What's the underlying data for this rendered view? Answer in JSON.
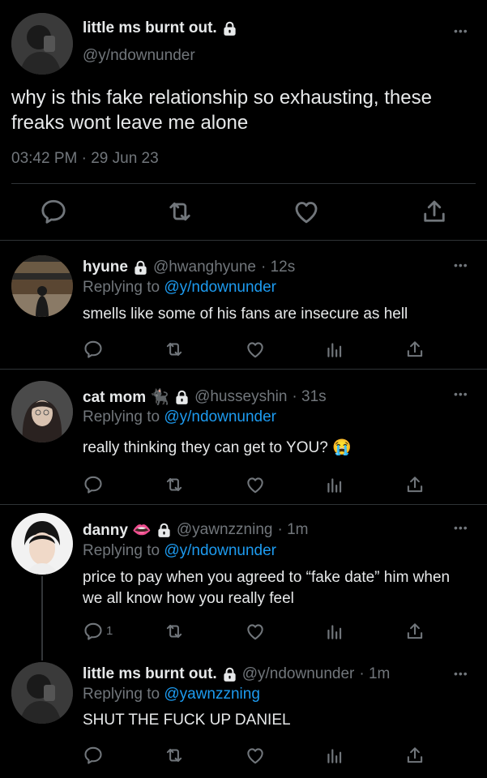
{
  "main_tweet": {
    "name": "little ms burnt out.",
    "handle": "@y/ndownunder",
    "text": "why is this fake relationship so exhausting, these freaks wont leave me alone",
    "time": "03:42 PM · 29 Jun 23",
    "more": "•••"
  },
  "replies": [
    {
      "name": "hyune",
      "handle": "@hwanghyune",
      "time": "· 12s",
      "replying_prefix": "Replying to",
      "replying_to": "@y/ndownunder",
      "text": "smells like some of his fans are insecure as hell",
      "reply_count": ""
    },
    {
      "name": "cat mom 🐈‍⬛",
      "handle": "@husseyshin",
      "time": "· 31s",
      "replying_prefix": "Replying to",
      "replying_to": "@y/ndownunder",
      "text": "really thinking they can get to YOU? 😭",
      "reply_count": ""
    },
    {
      "name": "danny 👄",
      "handle": "@yawnzzning",
      "time": "· 1m",
      "replying_prefix": "Replying to",
      "replying_to": "@y/ndownunder",
      "text": "price to pay when you agreed to “fake date” him when we all know how you really feel",
      "reply_count": "1"
    },
    {
      "name": "little ms burnt out.",
      "handle": "@y/ndownunder",
      "time": "· 1m",
      "replying_prefix": "Replying to",
      "replying_to": "@yawnzzning",
      "text": "SHUT THE FUCK UP DANIEL",
      "reply_count": ""
    }
  ],
  "colors": {
    "background": "#000000",
    "text": "#e7e9ea",
    "muted": "#71767b",
    "link": "#1d9bf0",
    "divider": "#2f3336"
  },
  "icons": [
    "lock-icon",
    "reply-icon",
    "retweet-icon",
    "like-icon",
    "views-icon",
    "share-icon",
    "more-icon"
  ]
}
